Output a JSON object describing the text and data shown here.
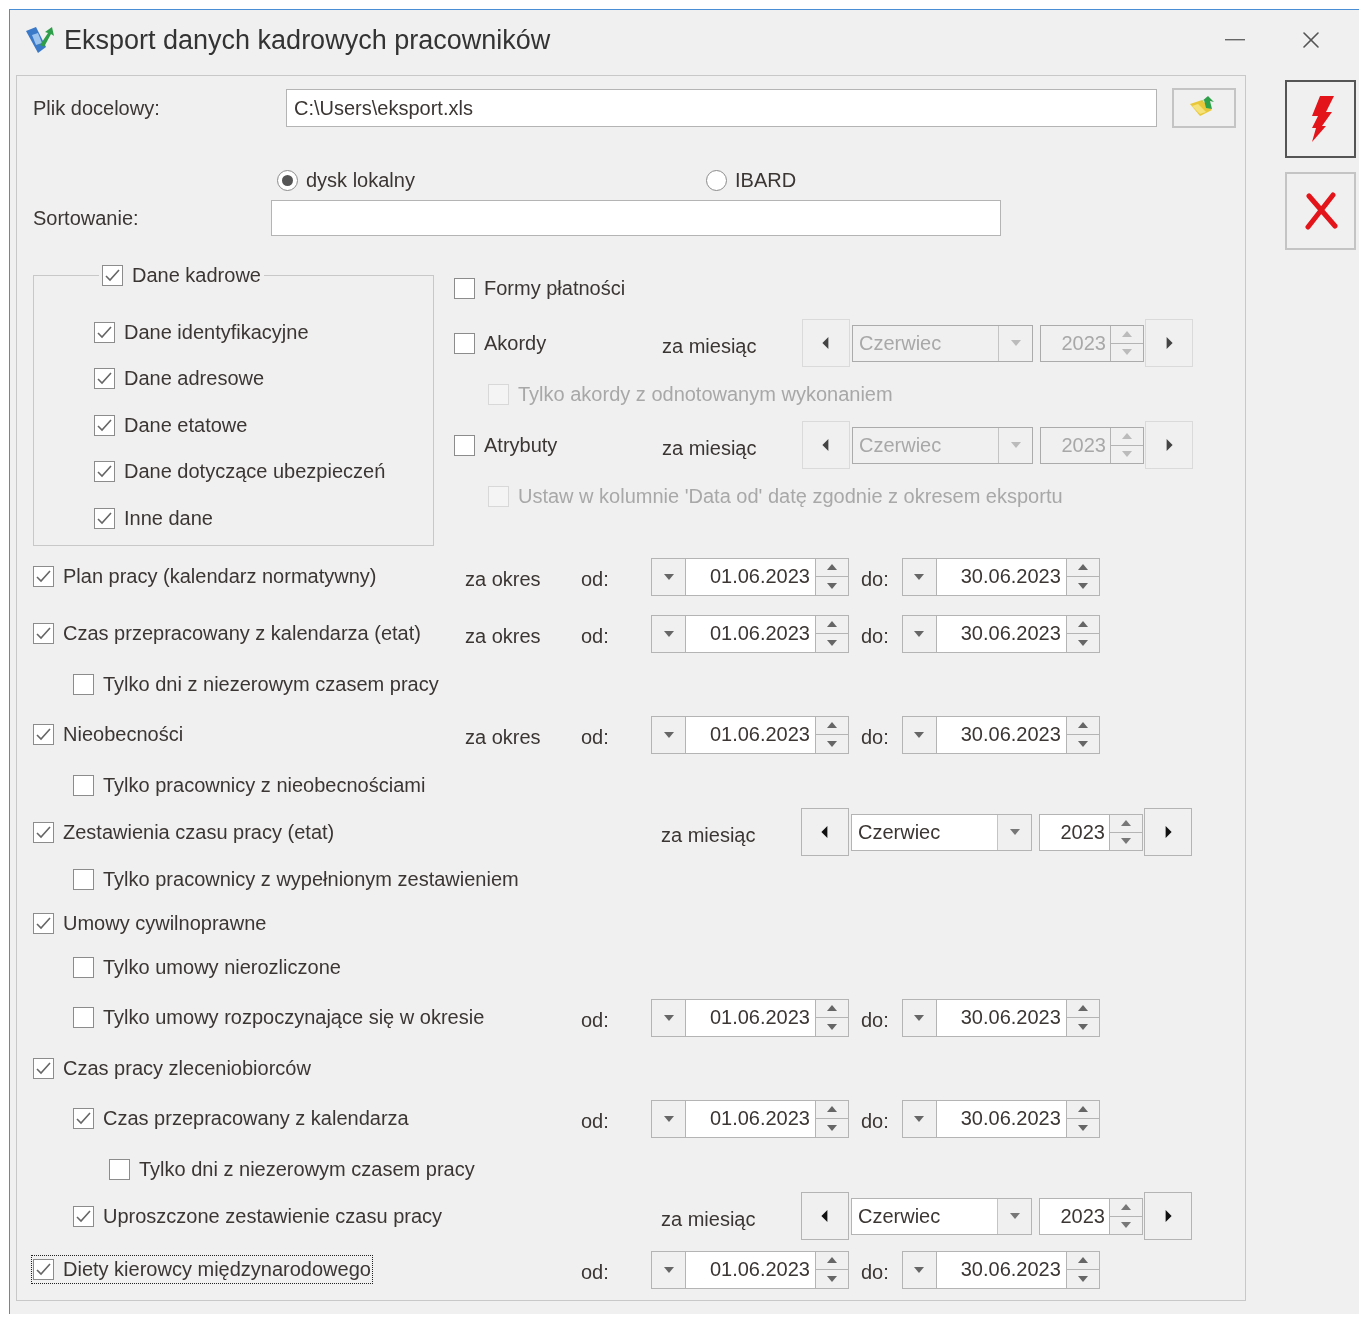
{
  "window": {
    "title": "Eksport danych kadrowych pracowników"
  },
  "target_file": {
    "label": "Plik docelowy:",
    "value": "C:\\Users\\eksport.xls"
  },
  "storage": [
    {
      "label": "dysk lokalny",
      "selected": true
    },
    {
      "label": "IBARD",
      "selected": false
    }
  ],
  "sorting": {
    "label": "Sortowanie:"
  },
  "hr_data": {
    "label": "Dane kadrowe",
    "checked": true,
    "items": [
      {
        "label": "Dane identyfikacyjne",
        "checked": true
      },
      {
        "label": "Dane adresowe",
        "checked": true
      },
      {
        "label": "Dane etatowe",
        "checked": true
      },
      {
        "label": "Dane dotyczące ubezpieczeń",
        "checked": true
      },
      {
        "label": "Inne dane",
        "checked": true
      }
    ]
  },
  "other_options": [
    {
      "label": "Formy płatności",
      "checked": false,
      "disabled": false
    },
    {
      "label": "Akordy",
      "checked": false,
      "disabled": false,
      "period": {
        "kind": "month",
        "prefix": "za miesiąc",
        "month": "Czerwiec",
        "year": "2023",
        "disabled": true
      },
      "children": [
        {
          "label": "Tylko akordy z odnotowanym wykonaniem",
          "checked": false,
          "disabled": true
        }
      ]
    },
    {
      "label": "Atrybuty",
      "checked": false,
      "disabled": false,
      "period": {
        "kind": "month",
        "prefix": "za miesiąc",
        "month": "Czerwiec",
        "year": "2023",
        "disabled": true
      },
      "children": [
        {
          "label": "Ustaw w kolumnie 'Data od' datę zgodnie z okresem eksportu",
          "checked": false,
          "disabled": true
        }
      ]
    }
  ],
  "exports": [
    {
      "label": "Plan pracy (kalendarz normatywny)",
      "checked": true,
      "focused": false,
      "period": {
        "kind": "range",
        "prefix": "za okres",
        "from_label": "od:",
        "from": "01.06.2023",
        "to_label": "do:",
        "to": "30.06.2023"
      }
    },
    {
      "label": "Czas przepracowany z kalendarza (etat)",
      "checked": true,
      "focused": false,
      "period": {
        "kind": "range",
        "prefix": "za okres",
        "from_label": "od:",
        "from": "01.06.2023",
        "to_label": "do:",
        "to": "30.06.2023"
      },
      "children": [
        {
          "label": "Tylko dni z niezerowym czasem pracy",
          "checked": false
        }
      ]
    },
    {
      "label": "Nieobecności",
      "checked": true,
      "focused": false,
      "period": {
        "kind": "range",
        "prefix": "za okres",
        "from_label": "od:",
        "from": "01.06.2023",
        "to_label": "do:",
        "to": "30.06.2023"
      },
      "children": [
        {
          "label": "Tylko pracownicy z nieobecnościami",
          "checked": false
        }
      ]
    },
    {
      "label": "Zestawienia czasu pracy (etat)",
      "checked": true,
      "focused": false,
      "period": {
        "kind": "month",
        "prefix": "za miesiąc",
        "month": "Czerwiec",
        "year": "2023",
        "disabled": false
      },
      "children": [
        {
          "label": "Tylko pracownicy z wypełnionym zestawieniem",
          "checked": false
        }
      ]
    },
    {
      "label": "Umowy cywilnoprawne",
      "checked": true,
      "focused": false,
      "children": [
        {
          "label": "Tylko umowy nierozliczone",
          "checked": false
        },
        {
          "label": "Tylko umowy rozpoczynające się w okresie",
          "checked": false,
          "period": {
            "kind": "range",
            "from_label": "od:",
            "from": "01.06.2023",
            "to_label": "do:",
            "to": "30.06.2023"
          }
        }
      ]
    },
    {
      "label": "Czas pracy zleceniobiorców",
      "checked": true,
      "focused": false,
      "children": [
        {
          "label": "Czas przepracowany z kalendarza",
          "checked": true,
          "period": {
            "kind": "range",
            "from_label": "od:",
            "from": "01.06.2023",
            "to_label": "do:",
            "to": "30.06.2023"
          },
          "children": [
            {
              "label": "Tylko dni z niezerowym czasem pracy",
              "checked": false
            }
          ]
        },
        {
          "label": "Uproszczone zestawienie czasu pracy",
          "checked": true,
          "period": {
            "kind": "month",
            "prefix": "za miesiąc",
            "month": "Czerwiec",
            "year": "2023",
            "disabled": false
          }
        }
      ]
    },
    {
      "label": "Diety kierowcy międzynarodowego",
      "checked": true,
      "focused": true,
      "period": {
        "kind": "range",
        "from_label": "od:",
        "from": "01.06.2023",
        "to_label": "do:",
        "to": "30.06.2023"
      }
    }
  ]
}
